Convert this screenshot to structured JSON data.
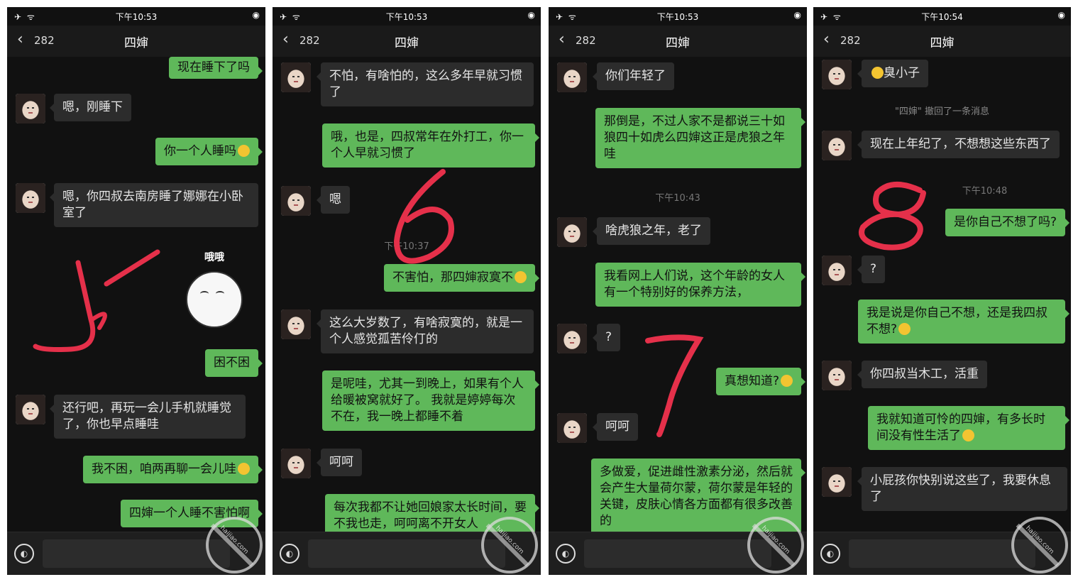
{
  "accent": {
    "green": "#5fb85a",
    "dark": "#111111",
    "annotation": "#e5304a"
  },
  "icons": {
    "back": "chevron-left-icon",
    "voice": "voice-icon",
    "status_left": "airplane-wifi-icon",
    "status_right": "location-icon"
  },
  "panels": [
    {
      "status_left": "✈ ᯤ",
      "time": "下午10:53",
      "back_count": "282",
      "title": "四婶",
      "watermark": "haijiao.com",
      "messages": [
        {
          "text": "现在睡下了吗"
        },
        {
          "text": "嗯，刚睡下"
        },
        {
          "text": "你一个人睡吗"
        },
        {
          "text": "嗯，你四叔去南房睡了娜娜在小卧室了"
        },
        {
          "text": "困不困"
        },
        {
          "text": "还行吧，再玩一会儿手机就睡觉了，你也早点睡哇"
        },
        {
          "text": "我不困，咱两再聊一会儿哇"
        },
        {
          "text": "四婶一个人睡不害怕啊"
        }
      ],
      "sticker_text": "哦哦",
      "annotation": "5"
    },
    {
      "status_left": "✈ ᯤ",
      "time": "下午10:53",
      "back_count": "282",
      "title": "四婶",
      "watermark": "haijiao.com",
      "timestamp": "下午10:37",
      "messages": [
        {
          "text": "不怕，有啥怕的，这么多年早就习惯了"
        },
        {
          "text": "哦，也是，四叔常年在外打工，你一个人早就习惯了"
        },
        {
          "text": "嗯"
        },
        {
          "text": "不害怕，那四婶寂寞不"
        },
        {
          "text": "这么大岁数了，有啥寂寞的，就是一个人感觉孤苦伶仃的"
        },
        {
          "text": "是呢哇，尤其一到晚上，如果有个人给暖被窝就好了。 我就是婷婷每次不在，我一晚上都睡不着"
        },
        {
          "text": "呵呵"
        },
        {
          "text": "每次我都不让她回娘家太长时间，要不我也走，呵呵离不开女人"
        }
      ],
      "annotation": "6"
    },
    {
      "status_left": "✈ ᯤ",
      "time": "下午10:53",
      "back_count": "282",
      "title": "四婶",
      "watermark": "haijiao.com",
      "timestamp": "下午10:43",
      "messages": [
        {
          "text": "你们年轻了"
        },
        {
          "text": "那倒是，不过人家不是都说三十如狼四十如虎么四婶这正是虎狼之年哇"
        },
        {
          "text": "啥虎狼之年，老了"
        },
        {
          "text": "我看网上人们说，这个年龄的女人有一个特别好的保养方法，"
        },
        {
          "text": "?"
        },
        {
          "text": "真想知道?"
        },
        {
          "text": "呵呵"
        },
        {
          "text": "多做爱，促进雌性激素分泌，然后就会产生大量荷尔蒙，荷尔蒙是年轻的关键，皮肤心情各方面都有很多改善的"
        }
      ],
      "annotation": "7"
    },
    {
      "status_left": "✈ ᯤ",
      "time": "下午10:54",
      "back_count": "282",
      "title": "四婶",
      "watermark": "haijiao.com",
      "timestamp": "下午10:48",
      "system": "\"四婶\" 撤回了一条消息",
      "messages": [
        {
          "text": "臭小子"
        },
        {
          "text": "现在上年纪了，不想想这些东西了"
        },
        {
          "text": "是你自己不想了吗?"
        },
        {
          "text": "?"
        },
        {
          "text": "我是说是你自己不想，还是我四叔不想?"
        },
        {
          "text": "你四叔当木工，活重"
        },
        {
          "text": "我就知道可怜的四婶，有多长时间没有性生活了"
        },
        {
          "text": "小屁孩你快别说这些了，我要休息了"
        }
      ],
      "annotation": "8"
    }
  ]
}
